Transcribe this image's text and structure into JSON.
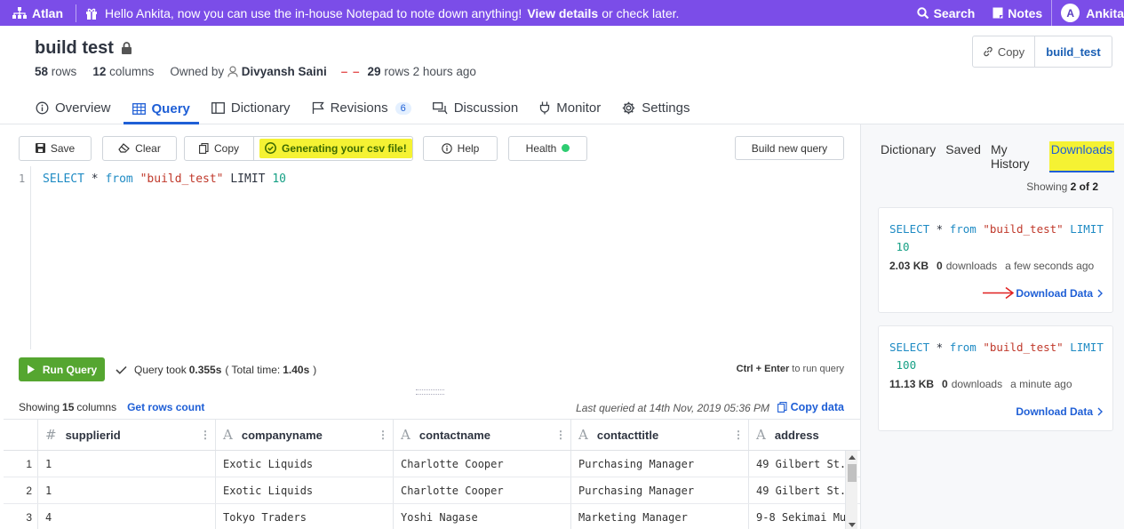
{
  "topbar": {
    "brand": "Atlan",
    "announcement_text": "Hello Ankita, now you can use the in-house Notepad to note down anything!",
    "announcement_link": "View details",
    "announcement_suffix": "or check later.",
    "search_label": "Search",
    "notes_label": "Notes",
    "user_initial": "A",
    "user_name": "Ankita",
    "bg_color": "#7b4de8"
  },
  "header": {
    "title": "build test",
    "rows_count": "58",
    "rows_label": "rows",
    "columns_count": "12",
    "columns_label": "columns",
    "owned_by_label": "Owned by",
    "owner": "Divyansh Saini",
    "dash": "– –",
    "sample_rows": "29",
    "sample_rows_label": "rows",
    "updated": "2 hours ago",
    "copy_label": "Copy",
    "table_name": "build_test"
  },
  "tabs": [
    {
      "label": "Overview",
      "icon": "info-circle-icon"
    },
    {
      "label": "Query",
      "icon": "table-grid-icon",
      "active": true
    },
    {
      "label": "Dictionary",
      "icon": "book-icon"
    },
    {
      "label": "Revisions",
      "icon": "flag-icon",
      "badge": "6"
    },
    {
      "label": "Discussion",
      "icon": "chat-icon"
    },
    {
      "label": "Monitor",
      "icon": "plug-icon"
    },
    {
      "label": "Settings",
      "icon": "gear-icon"
    }
  ],
  "toolbar": {
    "save": "Save",
    "clear": "Clear",
    "copy": "Copy",
    "generating": "Generating your csv file!",
    "help": "Help",
    "health": "Health",
    "build_new_query": "Build new query",
    "highlight_color": "#f5f233",
    "health_color": "#2ecc71"
  },
  "editor": {
    "line_number": "1",
    "kw1": "SELECT",
    "star": " * ",
    "kw2": "from",
    "table": "\"build_test\"",
    "kw3": " LIMIT ",
    "limit": "10"
  },
  "run": {
    "run_label": "Run Query",
    "took_prefix": "Query took",
    "took_value": "0.355s",
    "total_prefix": "( Total time:",
    "total_value": "1.40s",
    "total_suffix": ")",
    "shortcut_keys": "Ctrl + Enter",
    "shortcut_text": "to run query",
    "run_color": "#55a630"
  },
  "results": {
    "showing_prefix": "Showing",
    "showing_count": "15",
    "showing_suffix": "columns",
    "get_rows_count": "Get rows count",
    "last_queried": "Last queried at 14th Nov, 2019 05:36 PM",
    "copy_data": "Copy data",
    "columns": [
      {
        "type_icon": "#",
        "name": "supplierid"
      },
      {
        "type_icon": "A",
        "name": "companyname"
      },
      {
        "type_icon": "A",
        "name": "contactname"
      },
      {
        "type_icon": "A",
        "name": "contacttitle"
      },
      {
        "type_icon": "A",
        "name": "address"
      }
    ],
    "rows": [
      {
        "n": "1",
        "cells": [
          "1",
          "Exotic Liquids",
          "Charlotte Cooper",
          "Purchasing Manager",
          "49 Gilbert St."
        ]
      },
      {
        "n": "2",
        "cells": [
          "1",
          "Exotic Liquids",
          "Charlotte Cooper",
          "Purchasing Manager",
          "49 Gilbert St."
        ]
      },
      {
        "n": "3",
        "cells": [
          "4",
          "Tokyo Traders",
          "Yoshi Nagase",
          "Marketing Manager",
          "9-8 Sekimai Mu"
        ]
      }
    ]
  },
  "panel": {
    "tabs": [
      "Dictionary",
      "Saved",
      "My History",
      "Downloads"
    ],
    "active_tab": "Downloads",
    "showing_prefix": "Showing",
    "showing_value": "2 of 2",
    "downloads": [
      {
        "q_kw1": "SELECT",
        "q_star": " * ",
        "q_kw2": "from",
        "q_table": "\"build_test\"",
        "q_kw3": " LIMIT",
        "q_limit": "10",
        "size": "2.03 KB",
        "downloads_count": "0",
        "downloads_label": "downloads",
        "ago": "a few seconds ago",
        "link": "Download Data"
      },
      {
        "q_kw1": "SELECT",
        "q_star": " * ",
        "q_kw2": "from",
        "q_table": "\"build_test\"",
        "q_kw3": " LIMIT",
        "q_limit": "100",
        "size": "11.13 KB",
        "downloads_count": "0",
        "downloads_label": "downloads",
        "ago": "a minute ago",
        "link": "Download Data"
      }
    ]
  }
}
